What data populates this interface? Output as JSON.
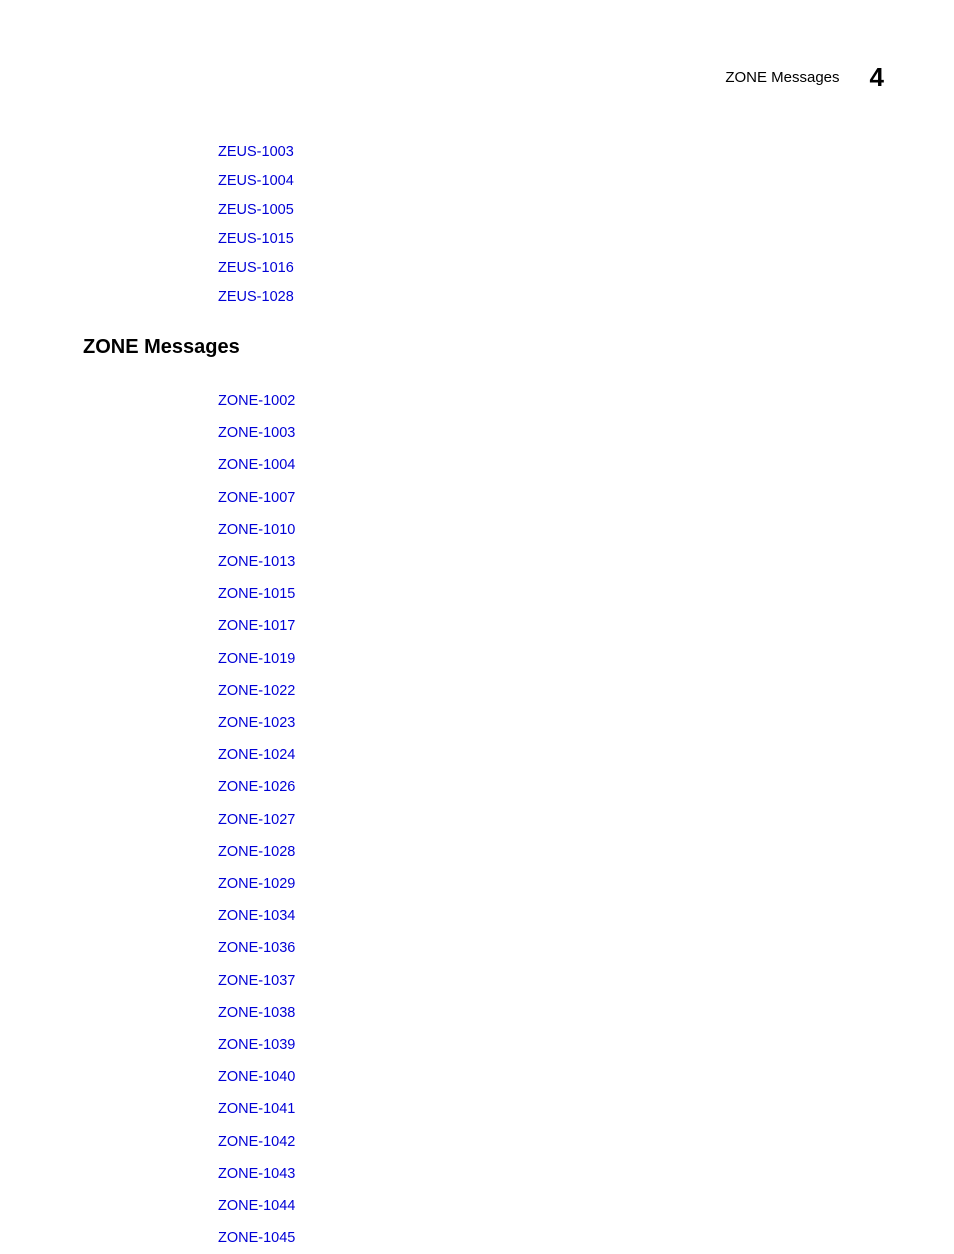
{
  "header": {
    "title": "ZONE Messages",
    "chapter_number": "4"
  },
  "zeus_links": [
    "ZEUS-1003",
    "ZEUS-1004",
    "ZEUS-1005",
    "ZEUS-1015",
    "ZEUS-1016",
    "ZEUS-1028"
  ],
  "section_heading": "ZONE Messages",
  "zone_links": [
    "ZONE-1002",
    "ZONE-1003",
    "ZONE-1004",
    "ZONE-1007",
    "ZONE-1010",
    "ZONE-1013",
    "ZONE-1015",
    "ZONE-1017",
    "ZONE-1019",
    "ZONE-1022",
    "ZONE-1023",
    "ZONE-1024",
    "ZONE-1026",
    "ZONE-1027",
    "ZONE-1028",
    "ZONE-1029",
    "ZONE-1034",
    "ZONE-1036",
    "ZONE-1037",
    "ZONE-1038",
    "ZONE-1039",
    "ZONE-1040",
    "ZONE-1041",
    "ZONE-1042",
    "ZONE-1043",
    "ZONE-1044",
    "ZONE-1045"
  ]
}
